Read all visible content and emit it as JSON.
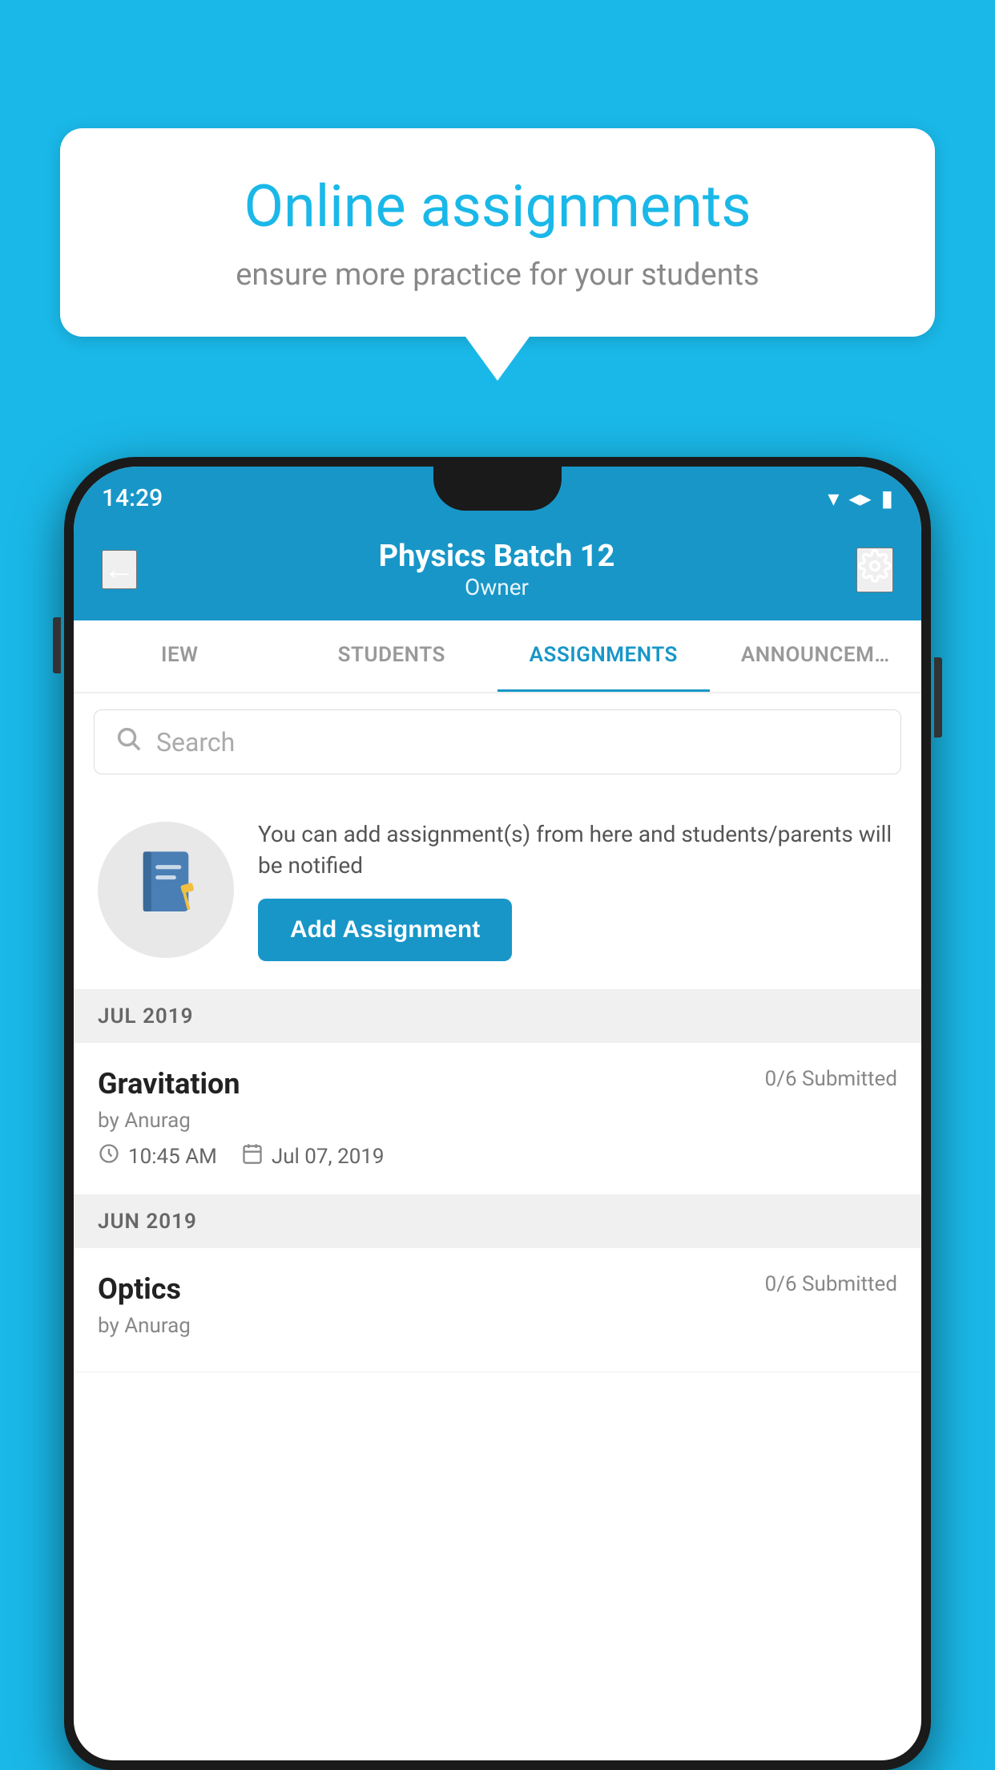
{
  "background": {
    "color": "#1ab8e8"
  },
  "speech_bubble": {
    "title": "Online assignments",
    "subtitle": "ensure more practice for your students"
  },
  "status_bar": {
    "time": "14:29"
  },
  "app_header": {
    "title": "Physics Batch 12",
    "subtitle": "Owner",
    "back_label": "←"
  },
  "tabs": [
    {
      "label": "IEW",
      "active": false
    },
    {
      "label": "STUDENTS",
      "active": false
    },
    {
      "label": "ASSIGNMENTS",
      "active": true
    },
    {
      "label": "ANNOUNCEM…",
      "active": false
    }
  ],
  "search": {
    "placeholder": "Search"
  },
  "info_card": {
    "description": "You can add assignment(s) from here and students/parents will be notified",
    "add_button_label": "Add Assignment"
  },
  "sections": [
    {
      "header": "JUL 2019",
      "assignments": [
        {
          "name": "Gravitation",
          "submitted": "0/6 Submitted",
          "author": "by Anurag",
          "time": "10:45 AM",
          "date": "Jul 07, 2019"
        }
      ]
    },
    {
      "header": "JUN 2019",
      "assignments": [
        {
          "name": "Optics",
          "submitted": "0/6 Submitted",
          "author": "by Anurag",
          "time": "",
          "date": ""
        }
      ]
    }
  ]
}
